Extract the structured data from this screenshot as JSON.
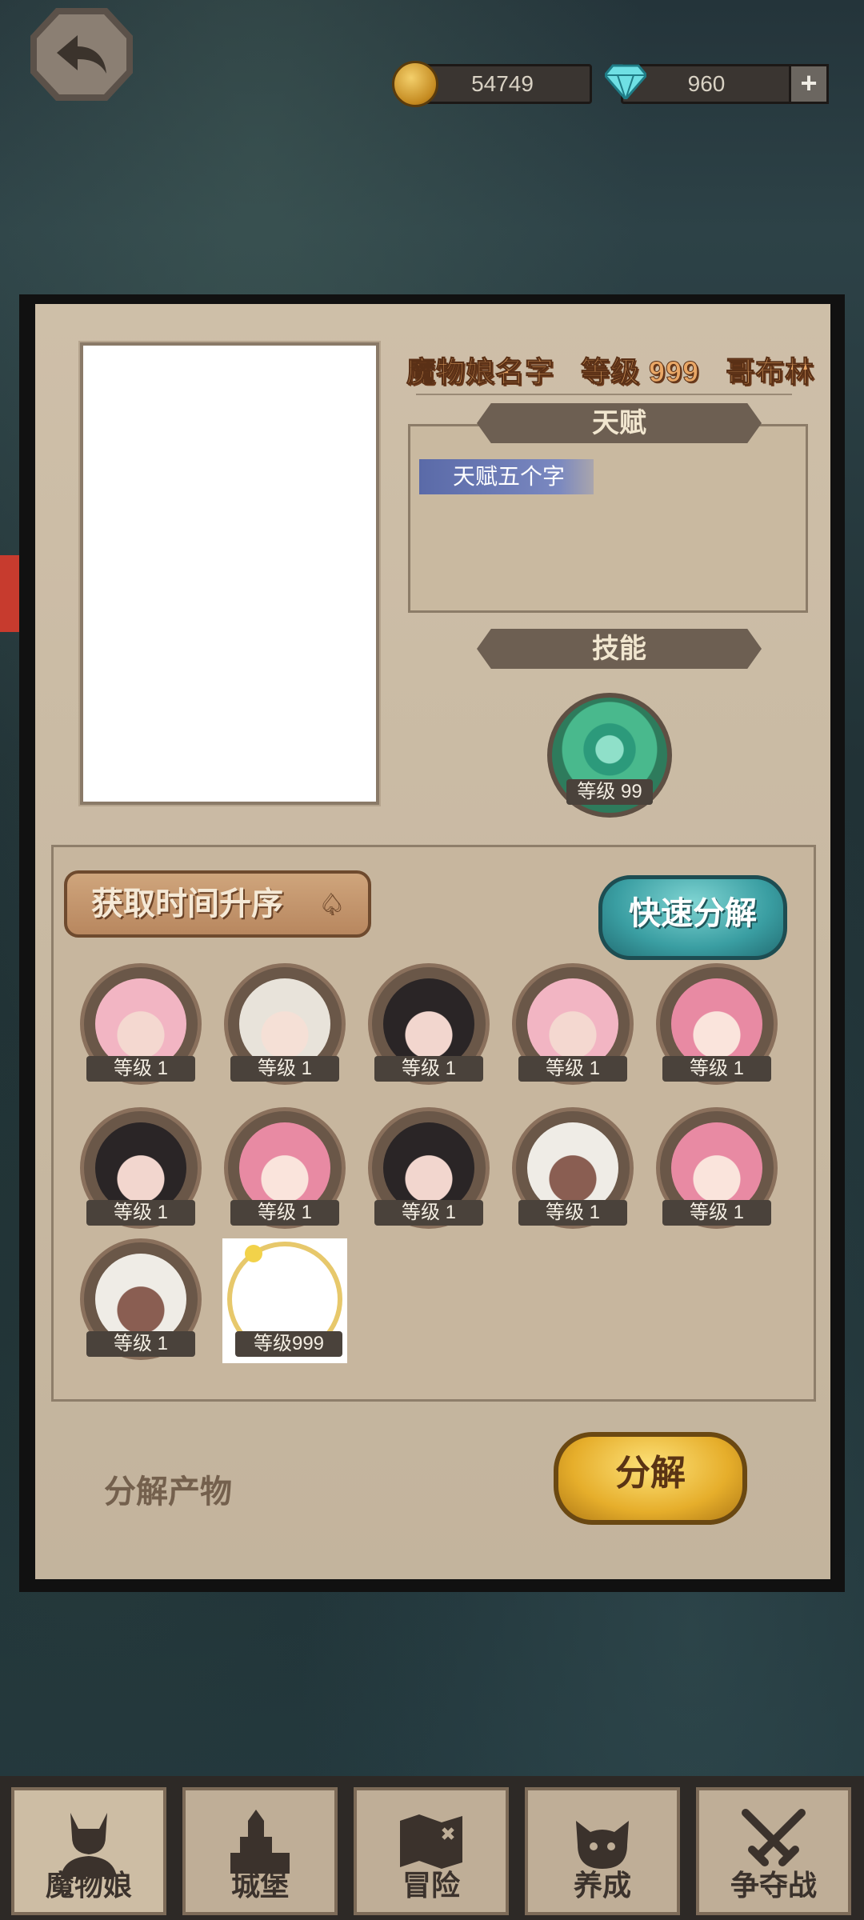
{
  "resources": {
    "gold": "54749",
    "diamonds": "960",
    "plus": "+"
  },
  "character": {
    "name": "魔物娘名字",
    "level_text": "等级 999",
    "race": "哥布林",
    "talent_title": "天赋",
    "talent_tag": "天赋五个字",
    "skill_title": "技能",
    "skill_level": "等级 99"
  },
  "list": {
    "sort_label": "获取时间升序",
    "quick_decompose": "快速分解",
    "items": [
      {
        "level": "等级 1",
        "hair": "#f2b5c3",
        "skin": "#f4d8d0"
      },
      {
        "level": "等级 1",
        "hair": "#e8e3da",
        "skin": "#f5e0d6"
      },
      {
        "level": "等级 1",
        "hair": "#2a2526",
        "skin": "#f2d6ce"
      },
      {
        "level": "等级 1",
        "hair": "#f2b5c3",
        "skin": "#f4d8d0"
      },
      {
        "level": "等级 1",
        "hair": "#e88aa3",
        "skin": "#fae4dc"
      },
      {
        "level": "等级 1",
        "hair": "#2a2526",
        "skin": "#f2d6ce"
      },
      {
        "level": "等级 1",
        "hair": "#e88aa3",
        "skin": "#fae4dc"
      },
      {
        "level": "等级 1",
        "hair": "#2a2526",
        "skin": "#f2d6ce"
      },
      {
        "level": "等级 1",
        "hair": "#efece6",
        "skin": "#8a5e52"
      },
      {
        "level": "等级 1",
        "hair": "#e88aa3",
        "skin": "#fae4dc"
      },
      {
        "level": "等级 1",
        "hair": "#efece6",
        "skin": "#8a5e52"
      }
    ],
    "selected_level": "等级999"
  },
  "product_label": "分解产物",
  "decompose_button": "分解",
  "nav": [
    {
      "label": "魔物娘",
      "icon": "monster-girl-icon"
    },
    {
      "label": "城堡",
      "icon": "castle-icon"
    },
    {
      "label": "冒险",
      "icon": "map-icon"
    },
    {
      "label": "养成",
      "icon": "cat-icon"
    },
    {
      "label": "争夺战",
      "icon": "crossed-swords-icon"
    }
  ]
}
